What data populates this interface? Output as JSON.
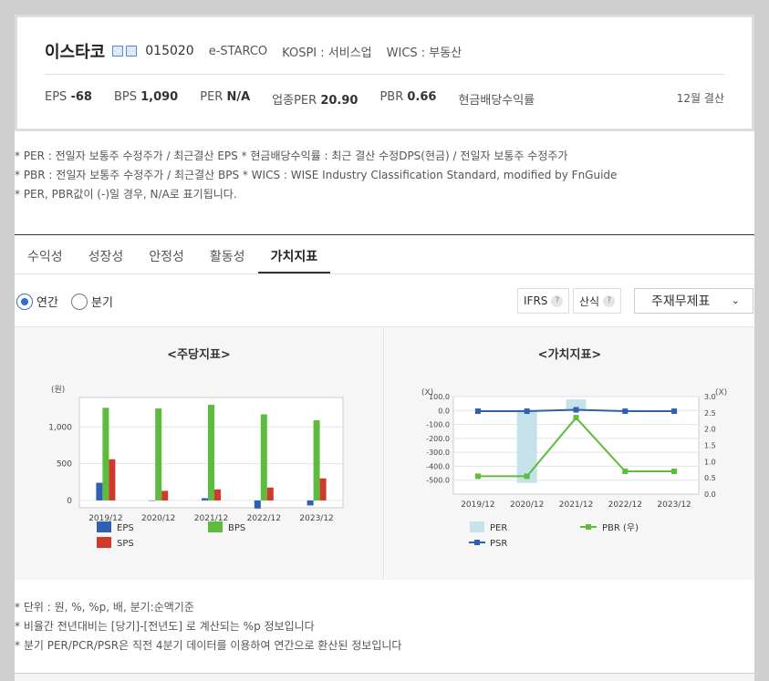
{
  "company": {
    "name": "이스타코",
    "code": "015020",
    "english_name": "e-STARCO",
    "market": "KOSPI : 서비스업",
    "wics": "WICS : 부동산"
  },
  "metrics": {
    "eps_label": "EPS",
    "eps": "-68",
    "bps_label": "BPS",
    "bps": "1,090",
    "per_label": "PER",
    "per": "N/A",
    "industry_per_label": "업종PER",
    "industry_per": "20.90",
    "pbr_label": "PBR",
    "pbr": "0.66",
    "dividend_label": "현금배당수익률",
    "settlement": "12월 결산"
  },
  "notes": [
    "* PER : 전일자 보통주 수정주가 / 최근결산 EPS * 현금배당수익률 : 최근 결산 수정DPS(현금) / 전일자 보통주 수정주가",
    "* PBR : 전일자 보통주 수정주가 / 최근결산 BPS * WICS : WISE Industry Classification Standard, modified by FnGuide",
    "* PER, PBR값이 (-)일 경우, N/A로 표기됩니다."
  ],
  "tabs": [
    "수익성",
    "성장성",
    "안정성",
    "활동성",
    "가치지표"
  ],
  "period": {
    "annual": "연간",
    "quarter": "분기"
  },
  "buttons": {
    "ifrs": "IFRS",
    "calc": "산식",
    "q": "?"
  },
  "select": {
    "value": "주재무제표",
    "chevron": "⌄"
  },
  "colors": {
    "eps": "#2f5fb3",
    "bps": "#5dbb3d",
    "sps": "#d0392b",
    "per": "#c5e2ea",
    "pbr": "#5dbb3d",
    "psr": "#2f5fb3"
  },
  "chart_data": [
    {
      "type": "bar",
      "title": "<주당지표>",
      "ylabel": "(원)",
      "categories": [
        "2019/12",
        "2020/12",
        "2021/12",
        "2022/12",
        "2023/12"
      ],
      "yticks": [
        "1,000",
        "500",
        "0"
      ],
      "ylim": [
        -100,
        1400
      ],
      "series": [
        {
          "name": "EPS",
          "values": [
            240,
            0,
            30,
            -110,
            -68
          ]
        },
        {
          "name": "BPS",
          "values": [
            1260,
            1250,
            1300,
            1170,
            1090
          ]
        },
        {
          "name": "SPS",
          "values": [
            560,
            130,
            150,
            175,
            300
          ]
        }
      ],
      "legend": "bottom"
    },
    {
      "type": "bar+line",
      "title": "<가치지표>",
      "ylabel_left": "(X)",
      "ylabel_right": "(X)",
      "categories": [
        "2019/12",
        "2020/12",
        "2021/12",
        "2022/12",
        "2023/12"
      ],
      "yticks_left": [
        "100.0",
        "0.0",
        "-100.0",
        "-200.0",
        "-300.0",
        "-400.0",
        "-500.0"
      ],
      "yticks_right": [
        "3.0",
        "2.5",
        "2.0",
        "1.5",
        "1.0",
        "0.5",
        "0.0"
      ],
      "ylim_left": [
        -600,
        100
      ],
      "ylim_right": [
        0,
        3
      ],
      "series": [
        {
          "name": "PER",
          "axis": "left",
          "kind": "bar",
          "values": [
            0,
            -520,
            80,
            0,
            0
          ]
        },
        {
          "name": "PBR (우)",
          "axis": "right",
          "kind": "line",
          "values": [
            0.55,
            0.55,
            2.35,
            0.7,
            0.7
          ]
        },
        {
          "name": "PSR",
          "axis": "left",
          "kind": "line",
          "values": [
            -5,
            -5,
            5,
            -5,
            -5
          ]
        }
      ],
      "legend": "bottom"
    }
  ]
}
